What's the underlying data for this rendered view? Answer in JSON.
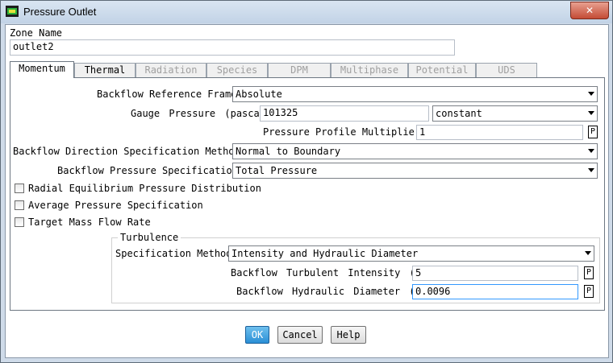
{
  "window": {
    "title": "Pressure Outlet",
    "close_glyph": "✕"
  },
  "zone": {
    "label": "Zone Name",
    "value": "outlet2"
  },
  "tabs": [
    {
      "label": "Momentum",
      "state": "active"
    },
    {
      "label": "Thermal",
      "state": "enabled"
    },
    {
      "label": "Radiation",
      "state": "disabled"
    },
    {
      "label": "Species",
      "state": "disabled"
    },
    {
      "label": "DPM",
      "state": "disabled"
    },
    {
      "label": "Multiphase",
      "state": "disabled"
    },
    {
      "label": "Potential",
      "state": "disabled"
    },
    {
      "label": "UDS",
      "state": "disabled"
    }
  ],
  "momentum": {
    "backflow_ref_frame": {
      "label": "Backflow Reference Frame",
      "value": "Absolute"
    },
    "gauge_pressure": {
      "label": "Gauge Pressure (pascal)",
      "value": "101325",
      "method": "constant"
    },
    "profile_multiplier": {
      "label": "Pressure Profile Multiplier",
      "value": "1",
      "p_button": "P"
    },
    "backflow_dir_method": {
      "label": "Backflow Direction Specification Method",
      "value": "Normal to Boundary"
    },
    "backflow_pressure_spec": {
      "label": "Backflow Pressure Specification",
      "value": "Total Pressure"
    },
    "checkboxes": [
      {
        "label": "Radial Equilibrium Pressure Distribution",
        "checked": false
      },
      {
        "label": "Average Pressure Specification",
        "checked": false
      },
      {
        "label": "Target Mass Flow Rate",
        "checked": false
      }
    ],
    "turbulence": {
      "group_label": "Turbulence",
      "spec_method": {
        "label": "Specification Method",
        "value": "Intensity and Hydraulic Diameter"
      },
      "intensity": {
        "label": "Backflow Turbulent Intensity (%)",
        "value": "5",
        "p_button": "P"
      },
      "hydraulic_diameter": {
        "label": "Backflow Hydraulic Diameter (m)",
        "value": "0.0096",
        "p_button": "P"
      }
    }
  },
  "buttons": {
    "ok": "OK",
    "cancel": "Cancel",
    "help": "Help"
  },
  "colors": {
    "title_bar": "#c8d8ea",
    "close": "#c8503a",
    "ok_button": "#3a9ee0",
    "focus_border": "#3399ff"
  }
}
